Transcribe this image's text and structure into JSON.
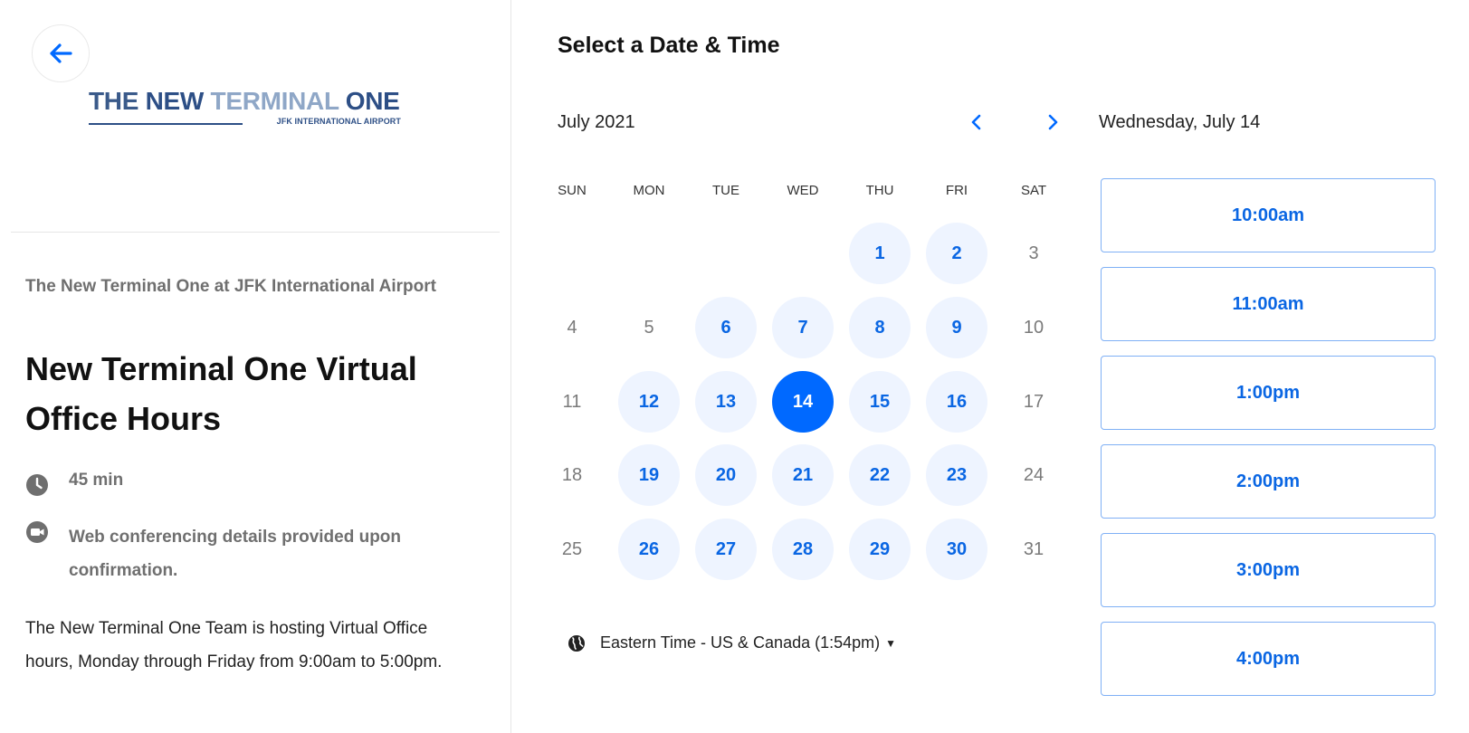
{
  "header": {
    "back_icon": "arrow-left-icon",
    "logo": {
      "words": [
        "THE",
        "NEW",
        "TERMINAL",
        "ONE"
      ],
      "subtitle": "JFK INTERNATIONAL AIRPORT",
      "colors": {
        "dark": "#2d4f86",
        "light": "#8fa7c7"
      }
    }
  },
  "event": {
    "organization": "The New Terminal One at JFK International Airport",
    "title": "New Terminal One Virtual Office Hours",
    "duration": "45 min",
    "duration_icon": "clock-icon",
    "conferencing": "Web conferencing details provided upon confirmation.",
    "conferencing_icon": "video-camera-icon",
    "description": "The New Terminal One Team is hosting Virtual Office hours, Monday through Friday from 9:00am to 5:00pm."
  },
  "scheduler": {
    "heading": "Select a Date & Time",
    "month_label": "July 2021",
    "prev_icon": "chevron-left-icon",
    "next_icon": "chevron-right-icon",
    "weekdays": [
      "SUN",
      "MON",
      "TUE",
      "WED",
      "THU",
      "FRI",
      "SAT"
    ],
    "weeks": [
      [
        null,
        null,
        null,
        null,
        {
          "d": "1",
          "s": "available"
        },
        {
          "d": "2",
          "s": "available"
        },
        {
          "d": "3",
          "s": "unavailable"
        }
      ],
      [
        {
          "d": "4",
          "s": "unavailable"
        },
        {
          "d": "5",
          "s": "unavailable"
        },
        {
          "d": "6",
          "s": "available"
        },
        {
          "d": "7",
          "s": "available"
        },
        {
          "d": "8",
          "s": "available"
        },
        {
          "d": "9",
          "s": "available"
        },
        {
          "d": "10",
          "s": "unavailable"
        }
      ],
      [
        {
          "d": "11",
          "s": "unavailable"
        },
        {
          "d": "12",
          "s": "available"
        },
        {
          "d": "13",
          "s": "available"
        },
        {
          "d": "14",
          "s": "selected"
        },
        {
          "d": "15",
          "s": "available"
        },
        {
          "d": "16",
          "s": "available"
        },
        {
          "d": "17",
          "s": "unavailable"
        }
      ],
      [
        {
          "d": "18",
          "s": "unavailable"
        },
        {
          "d": "19",
          "s": "available"
        },
        {
          "d": "20",
          "s": "available"
        },
        {
          "d": "21",
          "s": "available"
        },
        {
          "d": "22",
          "s": "available"
        },
        {
          "d": "23",
          "s": "available"
        },
        {
          "d": "24",
          "s": "unavailable"
        }
      ],
      [
        {
          "d": "25",
          "s": "unavailable"
        },
        {
          "d": "26",
          "s": "available"
        },
        {
          "d": "27",
          "s": "available"
        },
        {
          "d": "28",
          "s": "available"
        },
        {
          "d": "29",
          "s": "available"
        },
        {
          "d": "30",
          "s": "available"
        },
        {
          "d": "31",
          "s": "unavailable"
        }
      ]
    ],
    "timezone": "Eastern Time - US & Canada (1:54pm)",
    "timezone_icon": "globe-icon",
    "timezone_caret_icon": "caret-down-icon",
    "selected_date_label": "Wednesday, July 14",
    "time_slots": [
      "10:00am",
      "11:00am",
      "1:00pm",
      "2:00pm",
      "3:00pm",
      "4:00pm"
    ],
    "colors": {
      "accent": "#0069ff",
      "available_bg": "#eef4ff",
      "available_text": "#0a66e3"
    }
  }
}
